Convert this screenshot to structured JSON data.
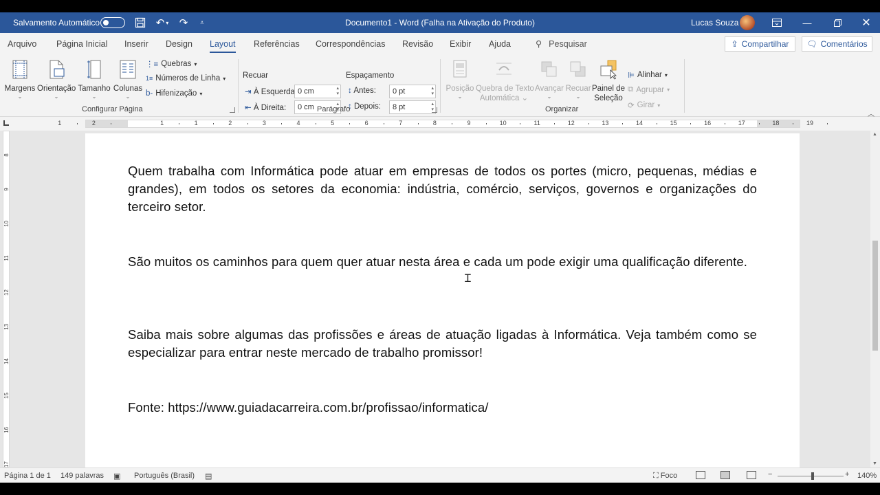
{
  "titlebar": {
    "autosave_label": "Salvamento Automático",
    "doc_title": "Documento1  -  Word (Falha na Ativação do Produto)",
    "user_name": "Lucas Souza"
  },
  "tabs": [
    {
      "label": "Arquivo"
    },
    {
      "label": "Página Inicial"
    },
    {
      "label": "Inserir"
    },
    {
      "label": "Design"
    },
    {
      "label": "Layout"
    },
    {
      "label": "Referências"
    },
    {
      "label": "Correspondências"
    },
    {
      "label": "Revisão"
    },
    {
      "label": "Exibir"
    },
    {
      "label": "Ajuda"
    }
  ],
  "search_label": "Pesquisar",
  "share_label": "Compartilhar",
  "comments_label": "Comentários",
  "ribbon": {
    "page_setup": {
      "margins": "Margens",
      "orientation": "Orientação",
      "size": "Tamanho",
      "columns": "Colunas",
      "breaks": "Quebras",
      "line_numbers": "Números de Linha",
      "hyphenation": "Hifenização",
      "group_label": "Configurar Página"
    },
    "paragraph": {
      "indent_title": "Recuar",
      "spacing_title": "Espaçamento",
      "left_label": "À Esquerda:",
      "left_value": "0 cm",
      "right_label": "À Direita:",
      "right_value": "0 cm",
      "before_label": "Antes:",
      "before_value": "0 pt",
      "after_label": "Depois:",
      "after_value": "8 pt",
      "group_label": "Parágrafo"
    },
    "arrange": {
      "position": "Posição",
      "wrap_line1": "Quebra de Texto",
      "wrap_line2": "Automática",
      "forward": "Avançar",
      "backward": "Recuar",
      "pane_line1": "Painel de",
      "pane_line2": "Seleção",
      "align": "Alinhar",
      "group": "Agrupar",
      "rotate": "Girar",
      "group_label": "Organizar"
    }
  },
  "document": {
    "paragraphs": [
      "Quem trabalha com Informática pode atuar em empresas de todos os portes (micro, pequenas, médias e grandes), em todos os setores da economia: indústria, comércio, serviços, governos e organizações do terceiro setor.",
      "São muitos os caminhos para quem quer atuar nesta área e cada um pode exigir uma qualificação diferente.",
      "Saiba mais sobre algumas das profissões e áreas de atuação ligadas à Informática. Veja também como se especializar para entrar neste mercado de trabalho promissor!",
      "Fonte: https://www.guiadacarreira.com.br/profissao/informatica/"
    ]
  },
  "statusbar": {
    "page": "Página 1 de 1",
    "words": "149 palavras",
    "language": "Português (Brasil)",
    "focus": "Foco",
    "zoom": "140%"
  },
  "ruler_numbers": [
    "1",
    "2",
    "1",
    "1",
    "2",
    "3",
    "4",
    "5",
    "6",
    "7",
    "8",
    "9",
    "10",
    "11",
    "12",
    "13",
    "14",
    "15",
    "16",
    "17",
    "18",
    "19"
  ],
  "vruler_numbers": [
    "8",
    "9",
    "10",
    "11",
    "12",
    "13",
    "14",
    "15",
    "16",
    "17"
  ],
  "colors": {
    "accent": "#2b579a",
    "ribbon_bg": "#f3f3f3",
    "doc_bg": "#e6e6e6"
  }
}
